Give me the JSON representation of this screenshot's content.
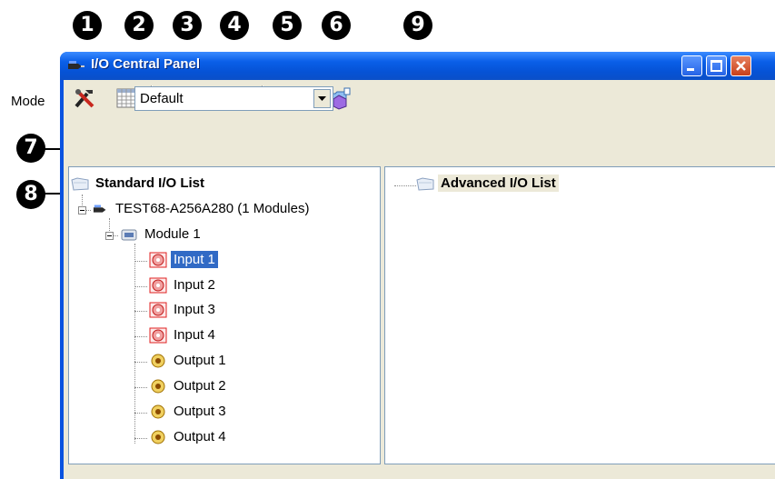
{
  "callouts": [
    "1",
    "2",
    "3",
    "4",
    "5",
    "6",
    "7",
    "8",
    "9"
  ],
  "window": {
    "title": "I/O Central Panel"
  },
  "toolbar": {
    "buttons": [
      {
        "icon": "tools-icon"
      },
      {
        "icon": "grid-icon"
      },
      {
        "icon": "cube-add-icon"
      },
      {
        "icon": "windows-icon"
      },
      {
        "icon": "dropdown-arrow-icon"
      },
      {
        "icon": "folder-cube-icon"
      },
      {
        "icon": "folder-cube-alt-icon"
      }
    ]
  },
  "mode": {
    "label": "Mode",
    "value": "Default"
  },
  "standard_list": {
    "title": "Standard I/O List",
    "device": "TEST68-A256A280 (1 Modules)",
    "module": "Module 1",
    "inputs": [
      "Input 1",
      "Input 2",
      "Input 3",
      "Input 4"
    ],
    "outputs": [
      "Output 1",
      "Output 2",
      "Output 3",
      "Output 4"
    ],
    "selected": "Input 1"
  },
  "advanced_list": {
    "title": "Advanced I/O List"
  },
  "colors": {
    "selection": "#316ac5",
    "titlebar": "#0a5fe8",
    "client": "#ece9d8",
    "input_icon": "#e02020",
    "output_icon": "#d49a00"
  }
}
